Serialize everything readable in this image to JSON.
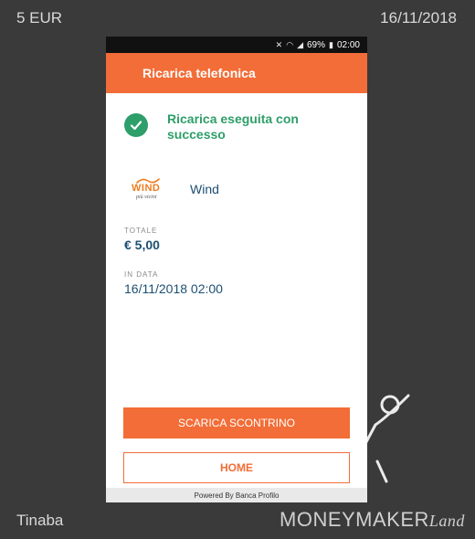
{
  "frame": {
    "amount": "5 EUR",
    "date": "16/11/2018",
    "app_name": "Tinaba",
    "brand_money": "MONEYMAKER",
    "brand_land": "Land"
  },
  "statusbar": {
    "battery": "69%",
    "time": "02:00"
  },
  "appbar": {
    "title": "Ricarica telefonica"
  },
  "success": {
    "message": "Ricarica eseguita con successo"
  },
  "operator": {
    "logo_text": "WIND",
    "logo_tagline": "più vicini",
    "name": "Wind"
  },
  "total": {
    "label": "TOTALE",
    "value": "€ 5,00"
  },
  "date_field": {
    "label": "IN DATA",
    "value": "16/11/2018 02:00"
  },
  "buttons": {
    "download": "SCARICA SCONTRINO",
    "home": "HOME"
  },
  "footer": {
    "text": "Powered By Banca Profilo"
  },
  "colors": {
    "accent": "#f26d37",
    "success": "#2e9e6a",
    "text_primary": "#1d4f73"
  }
}
